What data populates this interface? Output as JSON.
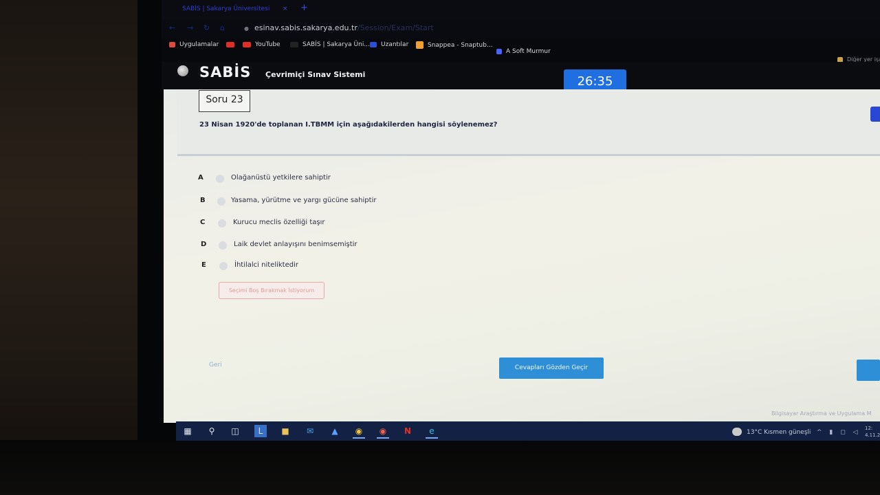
{
  "browser": {
    "tab_title": "SABİS | Sakarya Üniversitesi",
    "tab_close": "×",
    "new_tab": "+",
    "url_host": "esinav.sabis.sakarya.edu.tr",
    "url_path": "/Session/Exam/Start"
  },
  "bookmarks": [
    {
      "label": "Uygulamalar",
      "icon": "apps-grid-icon",
      "color": "#e04b3c"
    },
    {
      "label": "YouTube",
      "icon": "youtube-icon",
      "color": "#e52d27"
    },
    {
      "label": "SABİS | Sakarya Üni...",
      "icon": "sabis-icon",
      "color": "#222222"
    },
    {
      "label": "Uzantılar",
      "icon": "puzzle-icon",
      "color": "#2d4fd8"
    },
    {
      "label": "Snappea - Snaptub...",
      "icon": "snappea-icon",
      "color": "#f0a030"
    },
    {
      "label": "A Soft Murmur",
      "icon": "a-soft-murmur-icon",
      "color": "#4a63ff"
    }
  ],
  "other_bookmarks": "Diğer yer işa",
  "site": {
    "logo": "SABİS",
    "subtitle": "Çevrimiçi Sınav Sistemi",
    "timer": "26:35"
  },
  "question": {
    "number_label": "Soru 23",
    "text": "23 Nisan 1920'de toplanan I.TBMM için aşağıdakilerden hangisi söylenemez?",
    "options": [
      {
        "letter": "A",
        "text": "Olağanüstü yetkilere sahiptir"
      },
      {
        "letter": "B",
        "text": "Yasama, yürütme ve yargı gücüne sahiptir"
      },
      {
        "letter": "C",
        "text": "Kurucu meclis özelliği taşır"
      },
      {
        "letter": "D",
        "text": "Laik devlet anlayışını benimsemiştir"
      },
      {
        "letter": "E",
        "text": "İhtilalci niteliktedir"
      }
    ],
    "clear_button": "Seçimi Boş Bırakmak İstiyorum"
  },
  "nav": {
    "back": "Geri",
    "review": "Cevapları Gözden Geçir"
  },
  "footer": "Bilgisayar Araştırma ve Uygulama M",
  "taskbar": {
    "weather": "13°C  Kısmen güneşli",
    "clock_time": "12:",
    "clock_date": "4.11.20"
  },
  "colors": {
    "timer_bg": "#1f6fe0",
    "primary_button": "#2f8fd6",
    "clear_button_border": "#e6a9a3"
  }
}
